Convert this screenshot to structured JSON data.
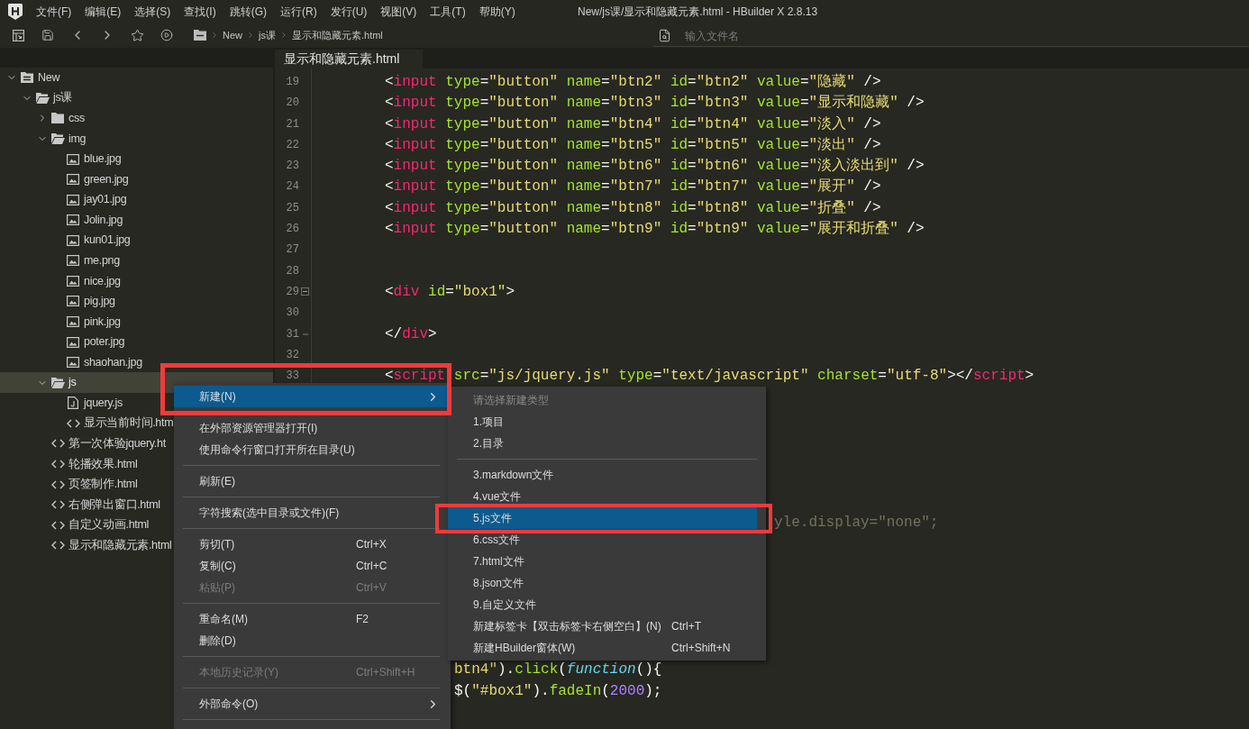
{
  "title_bar": {
    "menu": [
      "文件(F)",
      "编辑(E)",
      "选择(S)",
      "查找(I)",
      "跳转(G)",
      "运行(R)",
      "发行(U)",
      "视图(V)",
      "工具(T)",
      "帮助(Y)"
    ],
    "title": "New/js课/显示和隐藏元素.html - HBuilder X 2.8.13"
  },
  "toolbar": {
    "breadcrumb": [
      "New",
      "js课",
      "显示和隐藏元素.html"
    ],
    "search": {
      "placeholder": "输入文件名"
    }
  },
  "tabs": [
    {
      "label": "显示和隐藏元素.html",
      "selected": true
    }
  ],
  "sidebar": {
    "tree": [
      {
        "name": "New",
        "kind": "project",
        "expanded": true,
        "selected": false,
        "children": [
          {
            "name": "js课",
            "kind": "folder",
            "expanded": true,
            "selected": false,
            "children": [
              {
                "name": "css",
                "kind": "folder",
                "expanded": false,
                "selected": false
              },
              {
                "name": "img",
                "kind": "folder",
                "expanded": true,
                "selected": false,
                "children": [
                  {
                    "name": "blue.jpg",
                    "kind": "image",
                    "selected": false
                  },
                  {
                    "name": "green.jpg",
                    "kind": "image",
                    "selected": false
                  },
                  {
                    "name": "jay01.jpg",
                    "kind": "image",
                    "selected": false
                  },
                  {
                    "name": "Jolin.jpg",
                    "kind": "image",
                    "selected": false
                  },
                  {
                    "name": "kun01.jpg",
                    "kind": "image",
                    "selected": false
                  },
                  {
                    "name": "me.png",
                    "kind": "image",
                    "selected": false
                  },
                  {
                    "name": "nice.jpg",
                    "kind": "image",
                    "selected": false
                  },
                  {
                    "name": "pig.jpg",
                    "kind": "image",
                    "selected": false
                  },
                  {
                    "name": "pink.jpg",
                    "kind": "image",
                    "selected": false
                  },
                  {
                    "name": "poter.jpg",
                    "kind": "image",
                    "selected": false
                  },
                  {
                    "name": "shaohan.jpg",
                    "kind": "image",
                    "selected": false
                  }
                ]
              },
              {
                "name": "js",
                "kind": "folder",
                "expanded": true,
                "selected": true,
                "children": [
                  {
                    "name": "jquery.js",
                    "kind": "script",
                    "selected": false
                  },
                  {
                    "name": "显示当前时间.htm",
                    "kind": "html",
                    "selected": false
                  }
                ]
              },
              {
                "name": "第一次体验jquery.ht",
                "kind": "html",
                "selected": false
              },
              {
                "name": "轮播效果.html",
                "kind": "html",
                "selected": false
              },
              {
                "name": "页签制作.html",
                "kind": "html",
                "selected": false
              },
              {
                "name": "右侧弹出窗口.html",
                "kind": "html",
                "selected": false
              },
              {
                "name": "自定义动画.html",
                "kind": "html",
                "selected": false
              },
              {
                "name": "显示和隐藏元素.html",
                "kind": "html",
                "selected": false
              }
            ]
          }
        ]
      }
    ]
  },
  "editor": {
    "lines": [
      {
        "number": "19",
        "kind": "code",
        "tokens": [
          {
            "kind": "plain",
            "text": "<"
          },
          {
            "kind": "tag",
            "text": "input"
          },
          {
            "kind": "attr",
            "text": " type"
          },
          {
            "kind": "plain",
            "text": "="
          },
          {
            "kind": "string",
            "text": "\"button\""
          },
          {
            "kind": "attr",
            "text": " name"
          },
          {
            "kind": "plain",
            "text": "="
          },
          {
            "kind": "string",
            "text": "\"btn2\""
          },
          {
            "kind": "attr",
            "text": " id"
          },
          {
            "kind": "plain",
            "text": "="
          },
          {
            "kind": "string",
            "text": "\"btn2\""
          },
          {
            "kind": "attr",
            "text": " value"
          },
          {
            "kind": "plain",
            "text": "="
          },
          {
            "kind": "string",
            "text": "\"隐藏\""
          },
          {
            "kind": "plain",
            "text": " />"
          }
        ]
      },
      {
        "number": "20",
        "kind": "code",
        "tokens": [
          {
            "kind": "plain",
            "text": "<"
          },
          {
            "kind": "tag",
            "text": "input"
          },
          {
            "kind": "attr",
            "text": " type"
          },
          {
            "kind": "plain",
            "text": "="
          },
          {
            "kind": "string",
            "text": "\"button\""
          },
          {
            "kind": "attr",
            "text": " name"
          },
          {
            "kind": "plain",
            "text": "="
          },
          {
            "kind": "string",
            "text": "\"btn3\""
          },
          {
            "kind": "attr",
            "text": " id"
          },
          {
            "kind": "plain",
            "text": "="
          },
          {
            "kind": "string",
            "text": "\"btn3\""
          },
          {
            "kind": "attr",
            "text": " value"
          },
          {
            "kind": "plain",
            "text": "="
          },
          {
            "kind": "string",
            "text": "\"显示和隐藏\""
          },
          {
            "kind": "plain",
            "text": " />"
          }
        ]
      },
      {
        "number": "21",
        "kind": "code",
        "tokens": [
          {
            "kind": "plain",
            "text": "<"
          },
          {
            "kind": "tag",
            "text": "input"
          },
          {
            "kind": "attr",
            "text": " type"
          },
          {
            "kind": "plain",
            "text": "="
          },
          {
            "kind": "string",
            "text": "\"button\""
          },
          {
            "kind": "attr",
            "text": " name"
          },
          {
            "kind": "plain",
            "text": "="
          },
          {
            "kind": "string",
            "text": "\"btn4\""
          },
          {
            "kind": "attr",
            "text": " id"
          },
          {
            "kind": "plain",
            "text": "="
          },
          {
            "kind": "string",
            "text": "\"btn4\""
          },
          {
            "kind": "attr",
            "text": " value"
          },
          {
            "kind": "plain",
            "text": "="
          },
          {
            "kind": "string",
            "text": "\"淡入\""
          },
          {
            "kind": "plain",
            "text": " />"
          }
        ]
      },
      {
        "number": "22",
        "kind": "code",
        "tokens": [
          {
            "kind": "plain",
            "text": "<"
          },
          {
            "kind": "tag",
            "text": "input"
          },
          {
            "kind": "attr",
            "text": " type"
          },
          {
            "kind": "plain",
            "text": "="
          },
          {
            "kind": "string",
            "text": "\"button\""
          },
          {
            "kind": "attr",
            "text": " name"
          },
          {
            "kind": "plain",
            "text": "="
          },
          {
            "kind": "string",
            "text": "\"btn5\""
          },
          {
            "kind": "attr",
            "text": " id"
          },
          {
            "kind": "plain",
            "text": "="
          },
          {
            "kind": "string",
            "text": "\"btn5\""
          },
          {
            "kind": "attr",
            "text": " value"
          },
          {
            "kind": "plain",
            "text": "="
          },
          {
            "kind": "string",
            "text": "\"淡出\""
          },
          {
            "kind": "plain",
            "text": " />"
          }
        ]
      },
      {
        "number": "23",
        "kind": "code",
        "tokens": [
          {
            "kind": "plain",
            "text": "<"
          },
          {
            "kind": "tag",
            "text": "input"
          },
          {
            "kind": "attr",
            "text": " type"
          },
          {
            "kind": "plain",
            "text": "="
          },
          {
            "kind": "string",
            "text": "\"button\""
          },
          {
            "kind": "attr",
            "text": " name"
          },
          {
            "kind": "plain",
            "text": "="
          },
          {
            "kind": "string",
            "text": "\"btn6\""
          },
          {
            "kind": "attr",
            "text": " id"
          },
          {
            "kind": "plain",
            "text": "="
          },
          {
            "kind": "string",
            "text": "\"btn6\""
          },
          {
            "kind": "attr",
            "text": " value"
          },
          {
            "kind": "plain",
            "text": "="
          },
          {
            "kind": "string",
            "text": "\"淡入淡出到\""
          },
          {
            "kind": "plain",
            "text": " />"
          }
        ]
      },
      {
        "number": "24",
        "kind": "code",
        "tokens": [
          {
            "kind": "plain",
            "text": "<"
          },
          {
            "kind": "tag",
            "text": "input"
          },
          {
            "kind": "attr",
            "text": " type"
          },
          {
            "kind": "plain",
            "text": "="
          },
          {
            "kind": "string",
            "text": "\"button\""
          },
          {
            "kind": "attr",
            "text": " name"
          },
          {
            "kind": "plain",
            "text": "="
          },
          {
            "kind": "string",
            "text": "\"btn7\""
          },
          {
            "kind": "attr",
            "text": " id"
          },
          {
            "kind": "plain",
            "text": "="
          },
          {
            "kind": "string",
            "text": "\"btn7\""
          },
          {
            "kind": "attr",
            "text": " value"
          },
          {
            "kind": "plain",
            "text": "="
          },
          {
            "kind": "string",
            "text": "\"展开\""
          },
          {
            "kind": "plain",
            "text": " />"
          }
        ]
      },
      {
        "number": "25",
        "kind": "code",
        "tokens": [
          {
            "kind": "plain",
            "text": "<"
          },
          {
            "kind": "tag",
            "text": "input"
          },
          {
            "kind": "attr",
            "text": " type"
          },
          {
            "kind": "plain",
            "text": "="
          },
          {
            "kind": "string",
            "text": "\"button\""
          },
          {
            "kind": "attr",
            "text": " name"
          },
          {
            "kind": "plain",
            "text": "="
          },
          {
            "kind": "string",
            "text": "\"btn8\""
          },
          {
            "kind": "attr",
            "text": " id"
          },
          {
            "kind": "plain",
            "text": "="
          },
          {
            "kind": "string",
            "text": "\"btn8\""
          },
          {
            "kind": "attr",
            "text": " value"
          },
          {
            "kind": "plain",
            "text": "="
          },
          {
            "kind": "string",
            "text": "\"折叠\""
          },
          {
            "kind": "plain",
            "text": " />"
          }
        ]
      },
      {
        "number": "26",
        "kind": "code",
        "tokens": [
          {
            "kind": "plain",
            "text": "<"
          },
          {
            "kind": "tag",
            "text": "input"
          },
          {
            "kind": "attr",
            "text": " type"
          },
          {
            "kind": "plain",
            "text": "="
          },
          {
            "kind": "string",
            "text": "\"button\""
          },
          {
            "kind": "attr",
            "text": " name"
          },
          {
            "kind": "plain",
            "text": "="
          },
          {
            "kind": "string",
            "text": "\"btn9\""
          },
          {
            "kind": "attr",
            "text": " id"
          },
          {
            "kind": "plain",
            "text": "="
          },
          {
            "kind": "string",
            "text": "\"btn9\""
          },
          {
            "kind": "attr",
            "text": " value"
          },
          {
            "kind": "plain",
            "text": "="
          },
          {
            "kind": "string",
            "text": "\"展开和折叠\""
          },
          {
            "kind": "plain",
            "text": " />"
          }
        ]
      },
      {
        "number": "27",
        "kind": "code"
      },
      {
        "number": "28",
        "kind": "code"
      },
      {
        "number": "29",
        "kind": "fold_start",
        "tokens": [
          {
            "kind": "plain",
            "text": "<"
          },
          {
            "kind": "tag",
            "text": "div"
          },
          {
            "kind": "attr",
            "text": " id"
          },
          {
            "kind": "plain",
            "text": "="
          },
          {
            "kind": "string",
            "text": "\"box1\""
          },
          {
            "kind": "plain",
            "text": ">"
          }
        ]
      },
      {
        "number": "30",
        "kind": "code"
      },
      {
        "number": "31",
        "kind": "fold_end",
        "tokens": [
          {
            "kind": "plain",
            "text": "</"
          },
          {
            "kind": "tag",
            "text": "div"
          },
          {
            "kind": "plain",
            "text": ">"
          }
        ]
      },
      {
        "number": "32",
        "kind": "code"
      },
      {
        "number": "33",
        "kind": "code",
        "tokens": [
          {
            "kind": "plain",
            "text": "<"
          },
          {
            "kind": "tag",
            "text": "script"
          },
          {
            "kind": "attr",
            "text": " src"
          },
          {
            "kind": "plain",
            "text": "="
          },
          {
            "kind": "string",
            "text": "\"js/jquery.js\""
          },
          {
            "kind": "attr",
            "text": " type"
          },
          {
            "kind": "plain",
            "text": "="
          },
          {
            "kind": "string",
            "text": "\"text/javascript\""
          },
          {
            "kind": "attr",
            "text": " charset"
          },
          {
            "kind": "plain",
            "text": "="
          },
          {
            "kind": "string",
            "text": "\"utf-8\""
          },
          {
            "kind": "plain",
            "text": "></"
          },
          {
            "kind": "tag",
            "text": "script"
          },
          {
            "kind": "plain",
            "text": ">"
          }
        ]
      }
    ],
    "fragments": [
      {
        "tokens": [
          {
            "kind": "comment",
            "text": "yle.display=\"none\";"
          }
        ]
      },
      {
        "tokens": [
          {
            "kind": "string",
            "text": "btn4\""
          },
          {
            "kind": "plain",
            "text": ")."
          },
          {
            "kind": "func",
            "text": "click"
          },
          {
            "kind": "plain",
            "text": "("
          },
          {
            "kind": "keyword",
            "text": "function"
          },
          {
            "kind": "plain",
            "text": "(){"
          }
        ]
      },
      {
        "tokens": [
          {
            "kind": "plain",
            "text": "$("
          },
          {
            "kind": "string",
            "text": "\"#box1\""
          },
          {
            "kind": "plain",
            "text": ")."
          },
          {
            "kind": "func",
            "text": "fadeIn"
          },
          {
            "kind": "plain",
            "text": "("
          },
          {
            "kind": "number",
            "text": "2000"
          },
          {
            "kind": "plain",
            "text": ");"
          }
        ]
      }
    ]
  },
  "context_menu": {
    "items": [
      {
        "kind": "item",
        "label": "新建(N)",
        "selected": true,
        "disabled": false,
        "submenu": true,
        "framed": true
      },
      {
        "kind": "separator"
      },
      {
        "kind": "item",
        "label": "在外部资源管理器打开(I)",
        "selected": false,
        "disabled": false,
        "submenu": false,
        "framed": false
      },
      {
        "kind": "item",
        "label": "使用命令行窗口打开所在目录(U)",
        "selected": false,
        "disabled": false,
        "submenu": false,
        "framed": false
      },
      {
        "kind": "separator"
      },
      {
        "kind": "item",
        "label": "刷新(E)",
        "selected": false,
        "disabled": false,
        "submenu": false,
        "framed": false
      },
      {
        "kind": "separator"
      },
      {
        "kind": "item",
        "label": "字符搜索(选中目录或文件)(F)",
        "selected": false,
        "disabled": false,
        "submenu": false,
        "framed": false
      },
      {
        "kind": "separator"
      },
      {
        "kind": "item",
        "label": "剪切(T)",
        "shortcut": "Ctrl+X",
        "selected": false,
        "disabled": false,
        "submenu": false,
        "framed": false
      },
      {
        "kind": "item",
        "label": "复制(C)",
        "shortcut": "Ctrl+C",
        "selected": false,
        "disabled": false,
        "submenu": false,
        "framed": false
      },
      {
        "kind": "item",
        "label": "粘贴(P)",
        "shortcut": "Ctrl+V",
        "selected": false,
        "disabled": true,
        "submenu": false,
        "framed": false
      },
      {
        "kind": "separator"
      },
      {
        "kind": "item",
        "label": "重命名(M)",
        "shortcut": "F2",
        "selected": false,
        "disabled": false,
        "submenu": false,
        "framed": false
      },
      {
        "kind": "item",
        "label": "删除(D)",
        "selected": false,
        "disabled": false,
        "submenu": false,
        "framed": false
      },
      {
        "kind": "separator"
      },
      {
        "kind": "item",
        "label": "本地历史记录(Y)",
        "shortcut": "Ctrl+Shift+H",
        "selected": false,
        "disabled": true,
        "submenu": false,
        "framed": false
      },
      {
        "kind": "separator"
      },
      {
        "kind": "item",
        "label": "外部命令(O)",
        "selected": false,
        "disabled": false,
        "submenu": true,
        "framed": false
      },
      {
        "kind": "separator"
      }
    ]
  },
  "submenu": {
    "items": [
      {
        "kind": "header",
        "label": "请选择新建类型"
      },
      {
        "kind": "item",
        "label": "1.项目",
        "selected": false,
        "framed": false
      },
      {
        "kind": "item",
        "label": "2.目录",
        "selected": false,
        "framed": false
      },
      {
        "kind": "separator"
      },
      {
        "kind": "item",
        "label": "3.markdown文件",
        "selected": false,
        "framed": false
      },
      {
        "kind": "item",
        "label": "4.vue文件",
        "selected": false,
        "framed": false
      },
      {
        "kind": "item",
        "label": "5.js文件",
        "selected": true,
        "framed": true
      },
      {
        "kind": "item",
        "label": "6.css文件",
        "selected": false,
        "framed": false
      },
      {
        "kind": "item",
        "label": "7.html文件",
        "selected": false,
        "framed": false
      },
      {
        "kind": "item",
        "label": "8.json文件",
        "selected": false,
        "framed": false
      },
      {
        "kind": "item",
        "label": "9.自定义文件",
        "selected": false,
        "framed": false
      },
      {
        "kind": "item",
        "label": "新建标签卡【双击标签卡右侧空白】(N)",
        "shortcut": "Ctrl+T",
        "selected": false,
        "framed": false
      },
      {
        "kind": "item",
        "label": "新建HBuilder窗体(W)",
        "shortcut": "Ctrl+Shift+N",
        "selected": false,
        "framed": false
      }
    ]
  }
}
